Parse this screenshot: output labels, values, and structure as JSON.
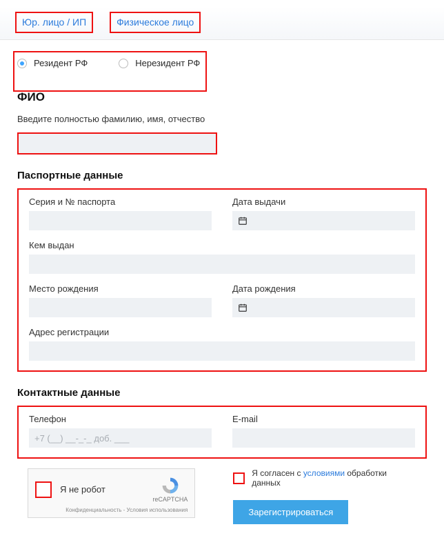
{
  "tabs": {
    "legal": "Юр. лицо / ИП",
    "individual": "Физическое лицо"
  },
  "resident": {
    "rf": "Резидент РФ",
    "non_rf": "Нерезидент РФ"
  },
  "fio": {
    "title": "ФИО",
    "helper": "Введите полностью фамилию, имя, отчество"
  },
  "passport": {
    "title": "Паспортные данные",
    "series": "Серия и № паспорта",
    "issue_date": "Дата выдачи",
    "issued_by": "Кем выдан",
    "birth_place": "Место рождения",
    "birth_date": "Дата рождения",
    "reg_address": "Адрес регистрации"
  },
  "contact": {
    "title": "Контактные данные",
    "phone_label": "Телефон",
    "phone_placeholder": "+7 (__) __-_-_ доб. ___",
    "email_label": "E-mail"
  },
  "captcha": {
    "label": "Я не робот",
    "brand": "reCAPTCHA",
    "legal": "Конфиденциальность - Условия использования"
  },
  "consent": {
    "prefix": "Я согласен с ",
    "link": "условиями",
    "suffix": " обработки данных"
  },
  "submit": "Зарегистрироваться"
}
